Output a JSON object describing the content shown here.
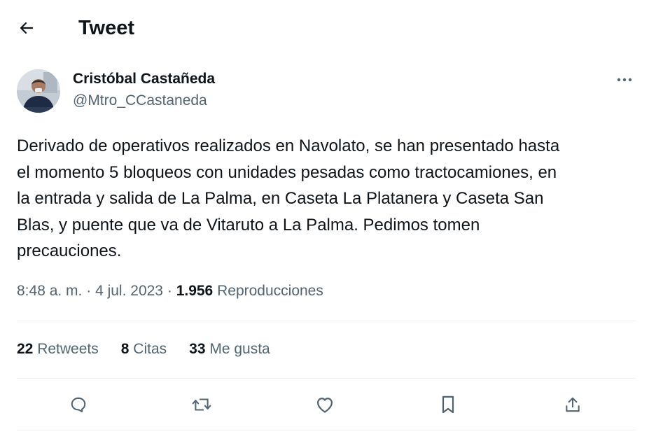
{
  "header": {
    "back_icon": "arrow-left-icon",
    "title": "Tweet"
  },
  "author": {
    "name": "Cristóbal Castañeda",
    "handle": "@Mtro_CCastaneda",
    "more_icon": "more-horizontal-icon"
  },
  "tweet": {
    "text": "Derivado de operativos realizados en Navolato, se han presentado hasta\nel momento 5 bloqueos con unidades pesadas como tractocamiones, en\nla entrada y salida de La Palma, en Caseta La Platanera y Caseta San\nBlas, y puente que va de Vitaruto a La Palma. Pedimos tomen\nprecauciones.",
    "time": "8:48 a. m.",
    "separator": "·",
    "date": "4 jul. 2023",
    "views_count": "1.956",
    "views_label": "Reproducciones"
  },
  "stats": {
    "retweets_count": "22",
    "retweets_label": "Retweets",
    "quotes_count": "8",
    "quotes_label": "Citas",
    "likes_count": "33",
    "likes_label": "Me gusta"
  },
  "actions": {
    "reply_icon": "reply-icon",
    "retweet_icon": "retweet-icon",
    "like_icon": "heart-icon",
    "bookmark_icon": "bookmark-icon",
    "share_icon": "share-icon"
  },
  "colors": {
    "text": "#0f1419",
    "secondary_text": "#536471",
    "divider": "#eff3f4",
    "background": "#ffffff"
  }
}
